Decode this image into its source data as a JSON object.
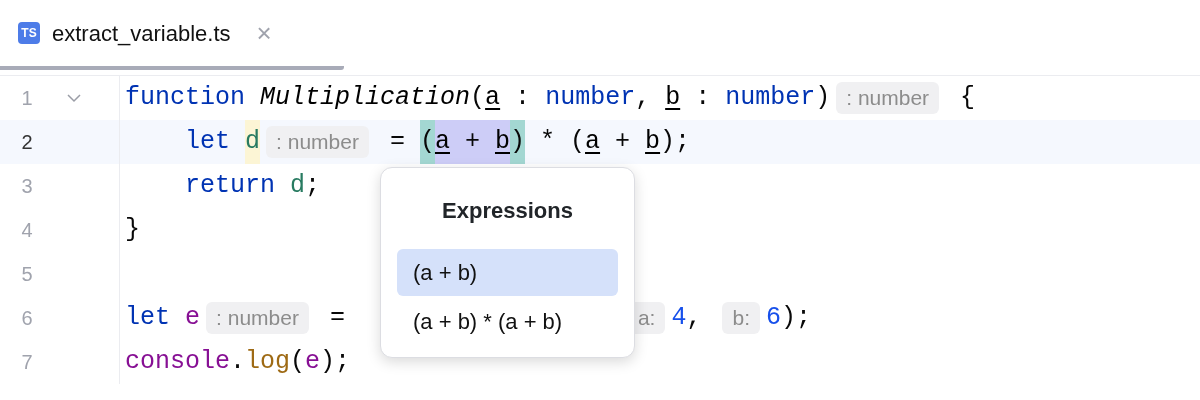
{
  "tabs": [
    {
      "icon": "TS",
      "label": "extract_variable.ts",
      "selected": true,
      "close": "×"
    }
  ],
  "lines": [
    {
      "number": "1",
      "current": false,
      "fold": true,
      "tokens": [
        {
          "text": "function ",
          "kind": "keyword"
        },
        {
          "text": "Multiplication",
          "kind": "fn"
        },
        {
          "text": "(",
          "kind": "punct"
        },
        {
          "text": "a",
          "kind": "param"
        },
        {
          "text": " : ",
          "kind": "punct"
        },
        {
          "text": "number",
          "kind": "keyword"
        },
        {
          "text": ", ",
          "kind": "punct"
        },
        {
          "text": "b",
          "kind": "param"
        },
        {
          "text": " : ",
          "kind": "punct"
        },
        {
          "text": "number",
          "kind": "keyword"
        },
        {
          "text": ")",
          "kind": "punct"
        },
        {
          "text": ": number",
          "kind": "hint"
        },
        {
          "text": " {",
          "kind": "punct"
        }
      ]
    },
    {
      "number": "2",
      "current": true,
      "fold": false,
      "tokens": [
        {
          "text": "    let ",
          "kind": "keyword",
          "usage_highlight": false,
          "brace_match": false,
          "in_selection": false
        },
        {
          "text": "d",
          "kind": "local",
          "usage_highlight": true,
          "brace_match": false,
          "in_selection": false
        },
        {
          "text": ": number",
          "kind": "hint",
          "usage_highlight": false,
          "brace_match": false,
          "in_selection": false
        },
        {
          "text": " = ",
          "kind": "punct",
          "usage_highlight": false,
          "brace_match": false,
          "in_selection": false
        },
        {
          "text": "(",
          "kind": "punct",
          "usage_highlight": false,
          "brace_match": true,
          "in_selection": false
        },
        {
          "text": "a",
          "kind": "param",
          "usage_highlight": false,
          "brace_match": false,
          "in_selection": true
        },
        {
          "text": " + ",
          "kind": "punct",
          "usage_highlight": false,
          "brace_match": false,
          "in_selection": true
        },
        {
          "text": "b",
          "kind": "param",
          "usage_highlight": false,
          "brace_match": false,
          "in_selection": true
        },
        {
          "text": ")",
          "kind": "punct",
          "usage_highlight": false,
          "brace_match": true,
          "in_selection": false
        },
        {
          "text": " * (",
          "kind": "punct",
          "usage_highlight": false,
          "brace_match": false,
          "in_selection": false
        },
        {
          "text": "a",
          "kind": "param",
          "usage_highlight": false,
          "brace_match": false,
          "in_selection": false
        },
        {
          "text": " + ",
          "kind": "punct",
          "usage_highlight": false,
          "brace_match": false,
          "in_selection": false
        },
        {
          "text": "b",
          "kind": "param",
          "usage_highlight": false,
          "brace_match": false,
          "in_selection": false
        },
        {
          "text": ");",
          "kind": "punct",
          "usage_highlight": false,
          "brace_match": false,
          "in_selection": false
        }
      ]
    },
    {
      "number": "3",
      "current": false,
      "fold": false,
      "tokens": [
        {
          "text": "    return ",
          "kind": "keyword"
        },
        {
          "text": "d",
          "kind": "local"
        },
        {
          "text": ";",
          "kind": "punct"
        }
      ]
    },
    {
      "number": "4",
      "current": false,
      "fold": false,
      "tokens": [
        {
          "text": "}",
          "kind": "punct"
        }
      ]
    },
    {
      "number": "5",
      "current": false,
      "fold": false
    },
    {
      "number": "6",
      "current": false,
      "fold": false,
      "tokens": [
        {
          "text": "let ",
          "kind": "keyword"
        },
        {
          "text": "e",
          "kind": "global"
        },
        {
          "text": ": number",
          "kind": "hint"
        },
        {
          "text": " = ",
          "kind": "punct"
        }
      ],
      "tokens_right_of_popup": [
        {
          "text": "a:",
          "kind": "hint"
        },
        {
          "text": "4",
          "kind": "number"
        },
        {
          "text": ", ",
          "kind": "punct"
        },
        {
          "text": "b:",
          "kind": "hint"
        },
        {
          "text": "6",
          "kind": "number"
        },
        {
          "text": ");",
          "kind": "punct"
        }
      ]
    },
    {
      "number": "7",
      "current": false,
      "fold": false,
      "tokens": [
        {
          "text": "console",
          "kind": "global"
        },
        {
          "text": ".",
          "kind": "punct"
        },
        {
          "text": "log",
          "kind": "method"
        },
        {
          "text": "(",
          "kind": "punct"
        },
        {
          "text": "e",
          "kind": "global"
        },
        {
          "text": ");",
          "kind": "punct"
        }
      ]
    }
  ],
  "popup": {
    "title": "Expressions",
    "items": [
      {
        "label": "(a + b)",
        "selected": true
      },
      {
        "label": "(a + b) * (a + b)",
        "selected": false
      }
    ]
  }
}
